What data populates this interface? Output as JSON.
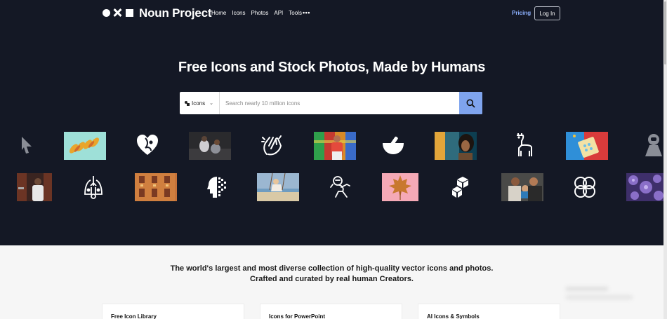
{
  "brand": {
    "name": "Noun Project"
  },
  "nav": {
    "items": [
      "Home",
      "Icons",
      "Photos",
      "API",
      "Tools"
    ],
    "more": "•••",
    "pricing": "Pricing",
    "login": "Log In"
  },
  "hero": {
    "headline": "Free Icons and Stock Photos, Made by Humans"
  },
  "search": {
    "type_label": "Icons",
    "placeholder": "Search nearly 10 million icons"
  },
  "gallery": {
    "row1": [
      "cursor-arrow-icon",
      "leaves-photo",
      "heart-face-icon",
      "people-on-couch-photo",
      "clapping-hands-icon",
      "man-in-colorful-room-photo",
      "mortar-pestle-icon",
      "woman-portrait-photo",
      "llama-icon",
      "pills-on-blue-photo",
      "astronaut-icon"
    ],
    "row2": [
      "man-in-doorway-photo",
      "lungs-icon",
      "building-windows-photo",
      "pixel-head-icon",
      "woman-on-swing-photo",
      "astronaut-dance-icon",
      "maple-leaf-photo",
      "cubes-icon",
      "couple-with-baby-photo",
      "circles-knot-icon",
      "purple-flowers-photo"
    ]
  },
  "tagline": {
    "line1": "The world's largest and most diverse collection of high-quality vector icons and photos.",
    "line2": "Crafted and curated by real human Creators."
  },
  "cards": [
    "Free Icon Library",
    "Icons for PowerPoint",
    "AI Icons & Symbols"
  ]
}
